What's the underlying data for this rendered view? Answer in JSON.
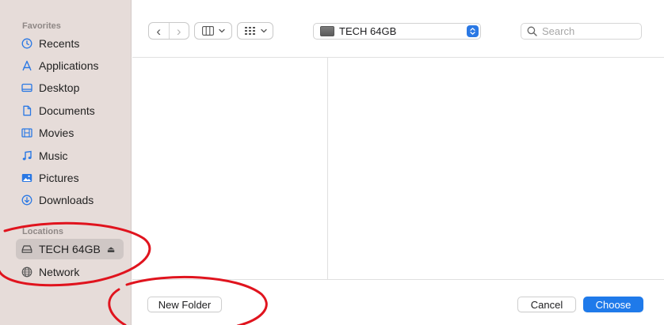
{
  "sidebar": {
    "favorites_title": "Favorites",
    "favorites": [
      {
        "label": "Recents",
        "icon": "clock-icon"
      },
      {
        "label": "Applications",
        "icon": "applications-icon"
      },
      {
        "label": "Desktop",
        "icon": "desktop-icon"
      },
      {
        "label": "Documents",
        "icon": "document-icon"
      },
      {
        "label": "Movies",
        "icon": "film-icon"
      },
      {
        "label": "Music",
        "icon": "music-note-icon"
      },
      {
        "label": "Pictures",
        "icon": "photo-icon"
      },
      {
        "label": "Downloads",
        "icon": "download-icon"
      }
    ],
    "locations_title": "Locations",
    "locations": [
      {
        "label": "TECH 64GB",
        "icon": "drive-icon",
        "selected": true,
        "eject": "⏏"
      },
      {
        "label": "Network",
        "icon": "globe-icon"
      }
    ]
  },
  "toolbar": {
    "back": "‹",
    "forward": "›",
    "view_icon": "column-view-icon",
    "group_icon": "group-icon",
    "location": "TECH 64GB",
    "search_placeholder": "Search"
  },
  "footer": {
    "new_folder": "New Folder",
    "cancel": "Cancel",
    "choose": "Choose"
  },
  "colors": {
    "accent": "#1f7aea",
    "sidebar_bg": "#e6dcd9",
    "annotation": "#e0141e"
  }
}
